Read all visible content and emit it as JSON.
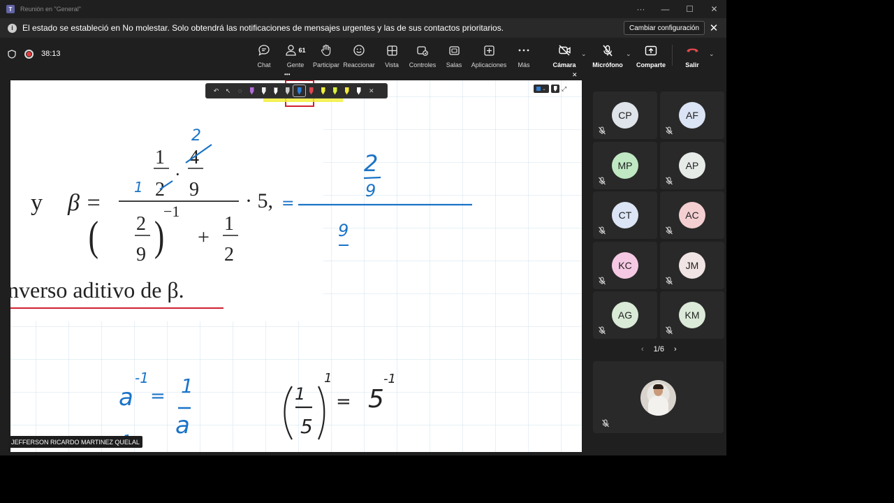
{
  "window": {
    "title": "Reunión en \"General\"",
    "controls": [
      "···",
      "—",
      "☐",
      "✕"
    ]
  },
  "notification": {
    "message": "El estado se estableció en No molestar. Solo obtendrá las notificaciones de mensajes urgentes y las de sus contactos prioritarios.",
    "button_label": "Cambiar configuración"
  },
  "meeting": {
    "timer": "38:13",
    "toolbar": {
      "chat": "Chat",
      "people": "Gente",
      "people_count": "61",
      "raise_hand": "Participar",
      "react": "Reaccionar",
      "view": "Vista",
      "rooms_controls": "Controles",
      "rooms": "Salas",
      "apps": "Aplicaciones",
      "more": "Más",
      "camera": "Cámara",
      "mic": "Micrófono",
      "share": "Comparte",
      "leave": "Salir"
    }
  },
  "stage": {
    "presenter": "JEFFERSON RICARDO MARTINEZ QUELAL",
    "content": {
      "y_label": "y",
      "beta_eq": "β =",
      "frac_top_num": "1",
      "frac_top_den": "2",
      "dot": "·",
      "frac_top2_num": "4",
      "frac_top2_den": "9",
      "paren_num": "2",
      "paren_den": "9",
      "exponent": "−1",
      "plus": "+",
      "half_num": "1",
      "half_den": "2",
      "times_five": "· 5,",
      "line_text": "nverso aditivo de β.",
      "ink_eq": "=",
      "ink_two_top": "2",
      "ink_one": "1",
      "ink_two_n": "2",
      "ink_nine_d": "9",
      "ink_nine": "9",
      "ink_a": "a",
      "ink_neg1": "-1",
      "ink_eq2": "=",
      "ink_one_a": "1",
      "ink_a_den": "a",
      "ink_one_s": "1",
      "ink_five": "5",
      "ink_exp1": "1",
      "ink_eq3": "=",
      "ink_five2": "5",
      "ink_neg1b": "-1",
      "ink_neg1c": "-1"
    }
  },
  "participants": [
    {
      "initials": "CP",
      "color": "#dfe3ea"
    },
    {
      "initials": "AF",
      "color": "#dbe4f4"
    },
    {
      "initials": "MP",
      "color": "#bfe8c3"
    },
    {
      "initials": "AP",
      "color": "#e6ebe8"
    },
    {
      "initials": "CT",
      "color": "#dbe5f5"
    },
    {
      "initials": "AC",
      "color": "#f4cfd2"
    },
    {
      "initials": "KC",
      "color": "#f5c9e3"
    },
    {
      "initials": "JM",
      "color": "#f1e4e4"
    },
    {
      "initials": "AG",
      "color": "#d9ead7"
    },
    {
      "initials": "KM",
      "color": "#dcebd9"
    }
  ],
  "pager": {
    "label": "1/6"
  },
  "colors": {
    "ink_blue": "#1a73c7",
    "underline_red": "#d1202f",
    "grid": "#c9dbea"
  },
  "icons": [
    "teams-icon",
    "info-icon",
    "shield-icon",
    "record-icon",
    "chat-icon",
    "people-icon",
    "hand-icon",
    "react-icon",
    "view-icon",
    "controls-icon",
    "rooms-icon",
    "apps-icon",
    "more-icon",
    "camera-off-icon",
    "mic-off-icon",
    "share-icon",
    "leave-icon"
  ]
}
